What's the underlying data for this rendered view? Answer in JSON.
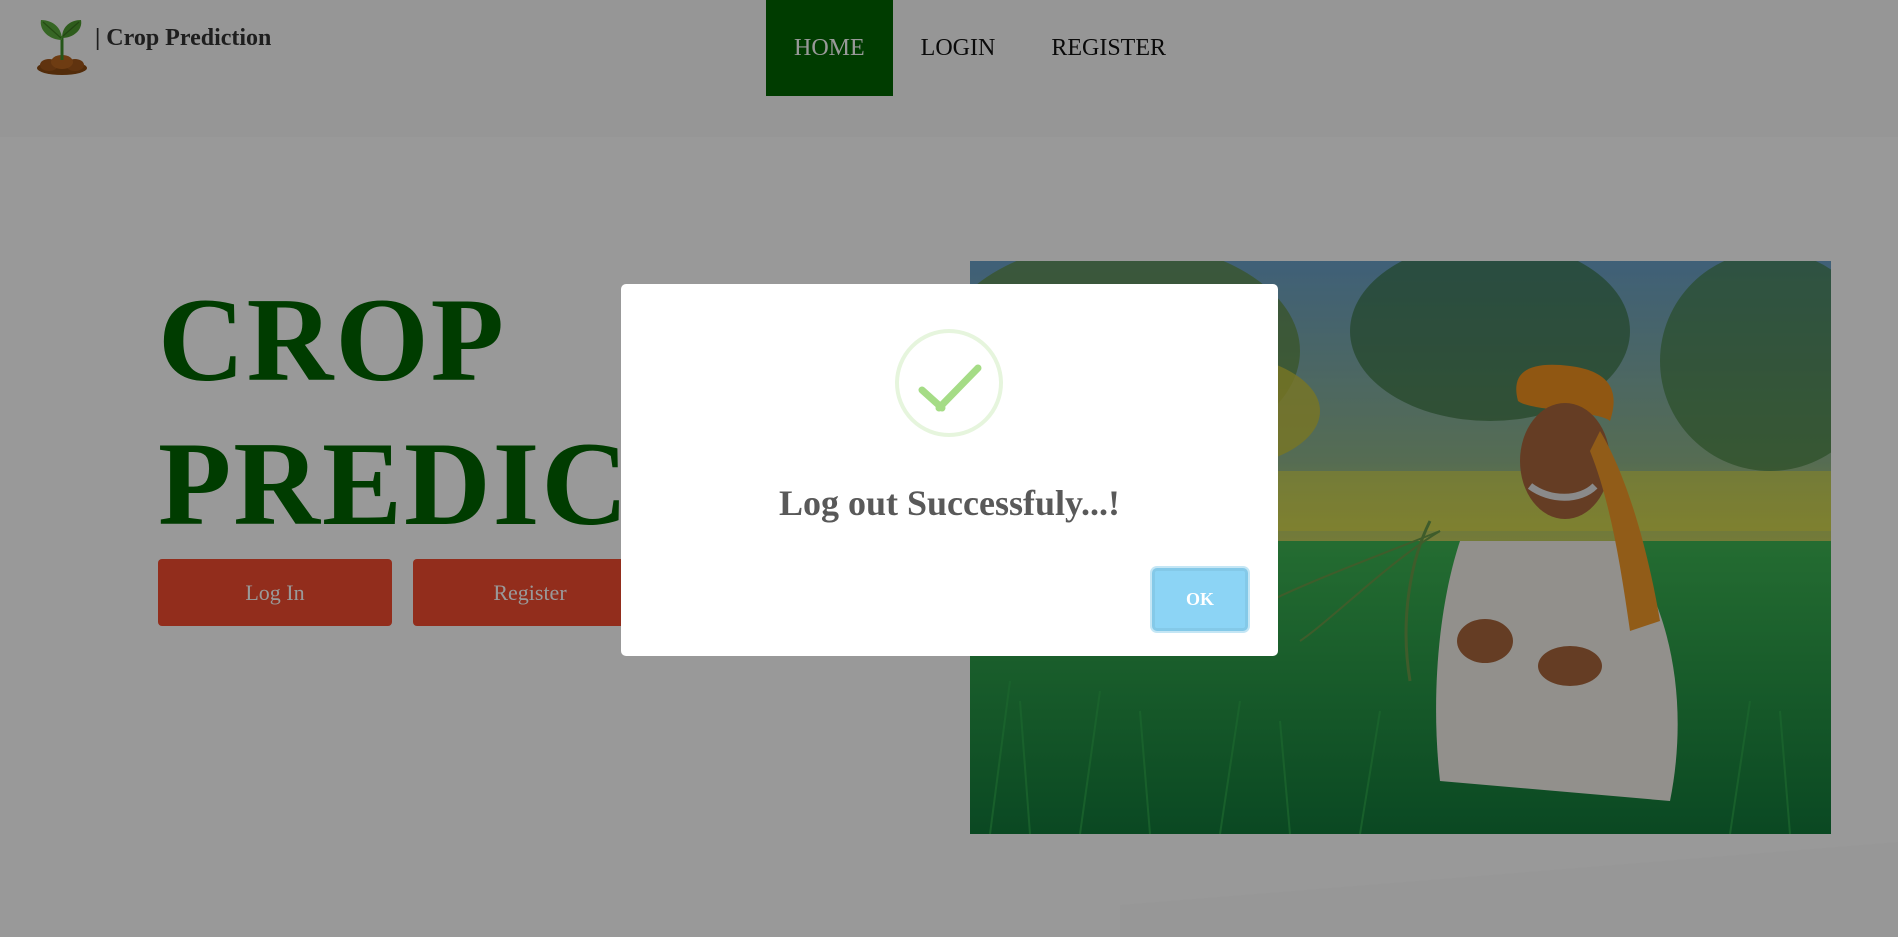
{
  "brand": {
    "name": "| Crop Prediction",
    "logo_icon": "sprout-icon"
  },
  "nav": {
    "items": [
      {
        "label": "HOME",
        "active": true
      },
      {
        "label": "LOGIN",
        "active": false
      },
      {
        "label": "REGISTER",
        "active": false
      }
    ]
  },
  "hero": {
    "title_line1": "CROP",
    "title_line2": "PREDICTION",
    "login_button": "Log In",
    "register_button": "Register",
    "photo": "farmer-in-field-photo"
  },
  "modal": {
    "icon": "success-check-icon",
    "message": "Log out Successfuly...!",
    "ok_button": "OK"
  },
  "colors": {
    "brand_green": "#006400",
    "button_red": "#f44b2f",
    "ok_blue": "#8cd4f5",
    "check_green": "#a5dc86"
  }
}
